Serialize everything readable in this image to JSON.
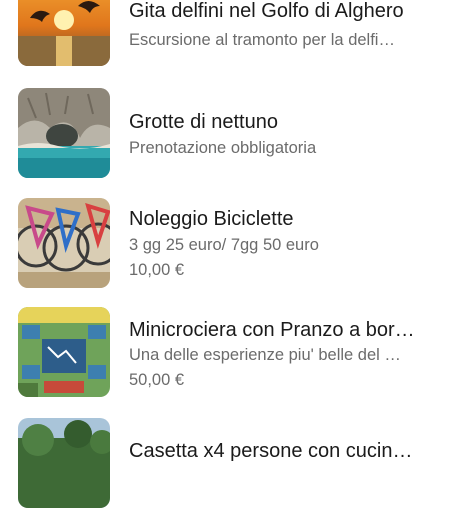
{
  "items": [
    {
      "title": "Gita delfini nel Golfo di Alghero",
      "subtitle": "Escursione al tramonto per la delfi…",
      "price": "",
      "image": "sunset-dolphins-image"
    },
    {
      "title": "Grotte di nettuno",
      "subtitle": "Prenotazione obbligatoria",
      "price": "",
      "image": "sea-cave-image"
    },
    {
      "title": "Noleggio Biciclette",
      "subtitle": "3 gg 25 euro/ 7gg 50 euro",
      "price": "10,00 €",
      "image": "bicycles-image"
    },
    {
      "title": "Minicrociera con Pranzo a bor…",
      "subtitle": "Una delle esperienze piu' belle del …",
      "price": "50,00 €",
      "image": "cruise-map-image"
    },
    {
      "title": "Casetta x4 persone con cucin…",
      "subtitle": "",
      "price": "",
      "image": "house-trees-image"
    }
  ]
}
